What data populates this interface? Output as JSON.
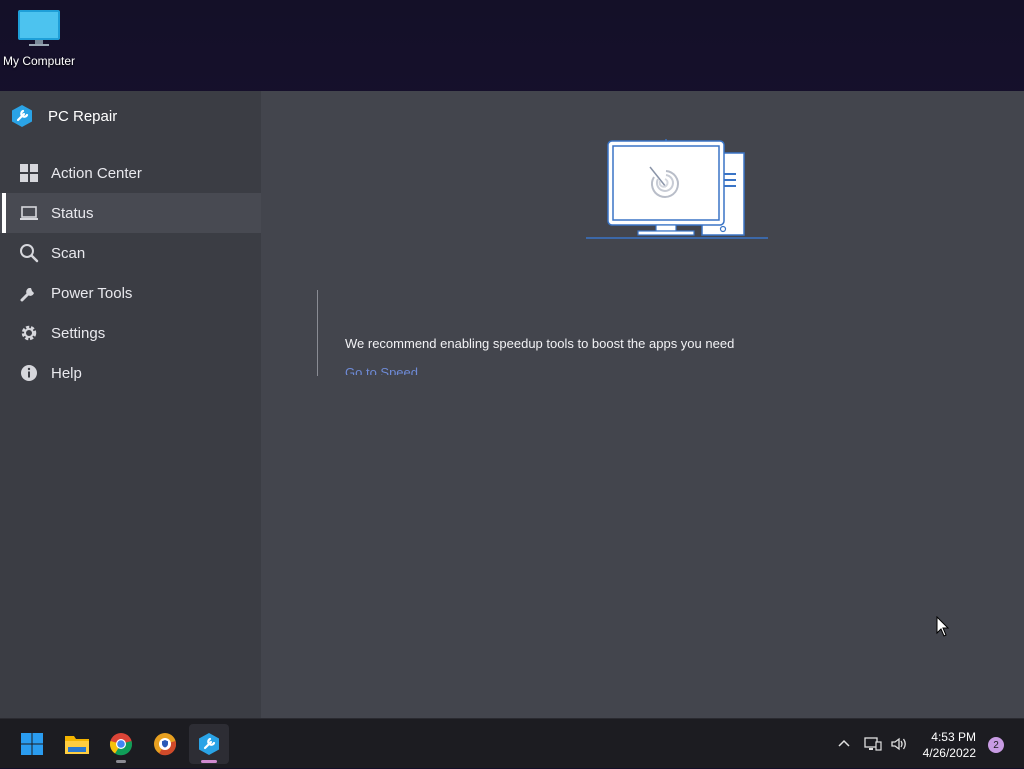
{
  "desktop": {
    "icons": [
      {
        "label": "My Computer",
        "icon": "monitor-icon"
      }
    ]
  },
  "app": {
    "title": "PC Repair",
    "logo_icon": "pc-repair-logo-icon",
    "nav": [
      {
        "label": "Action Center",
        "icon": "grid-icon",
        "active": false
      },
      {
        "label": "Status",
        "icon": "laptop-icon",
        "active": true
      },
      {
        "label": "Scan",
        "icon": "search-icon",
        "active": false
      },
      {
        "label": "Power Tools",
        "icon": "wrench-icon",
        "active": false
      },
      {
        "label": "Settings",
        "icon": "gear-icon",
        "active": false
      },
      {
        "label": "Help",
        "icon": "info-icon",
        "active": false
      }
    ],
    "main": {
      "illustration_icon": "computer-scan-illustration-icon",
      "recommendation_text": "We recommend enabling speedup tools to boost the apps you need",
      "recommendation_link": "Go to Speed"
    }
  },
  "taskbar": {
    "apps": [
      {
        "name": "Start",
        "icon": "windows-start-icon"
      },
      {
        "name": "File Explorer",
        "icon": "folder-icon"
      },
      {
        "name": "Google Chrome",
        "icon": "chrome-icon"
      },
      {
        "name": "Browser",
        "icon": "browser-shield-icon"
      },
      {
        "name": "PC Repair",
        "icon": "pc-repair-logo-icon"
      }
    ],
    "tray": {
      "time": "4:53 PM",
      "date": "4/26/2022",
      "notification_count": "2"
    }
  },
  "colors": {
    "accent_link": "#6e8ad6",
    "logo_blue": "#2aa3e6",
    "notification_badge": "#c89be3"
  }
}
